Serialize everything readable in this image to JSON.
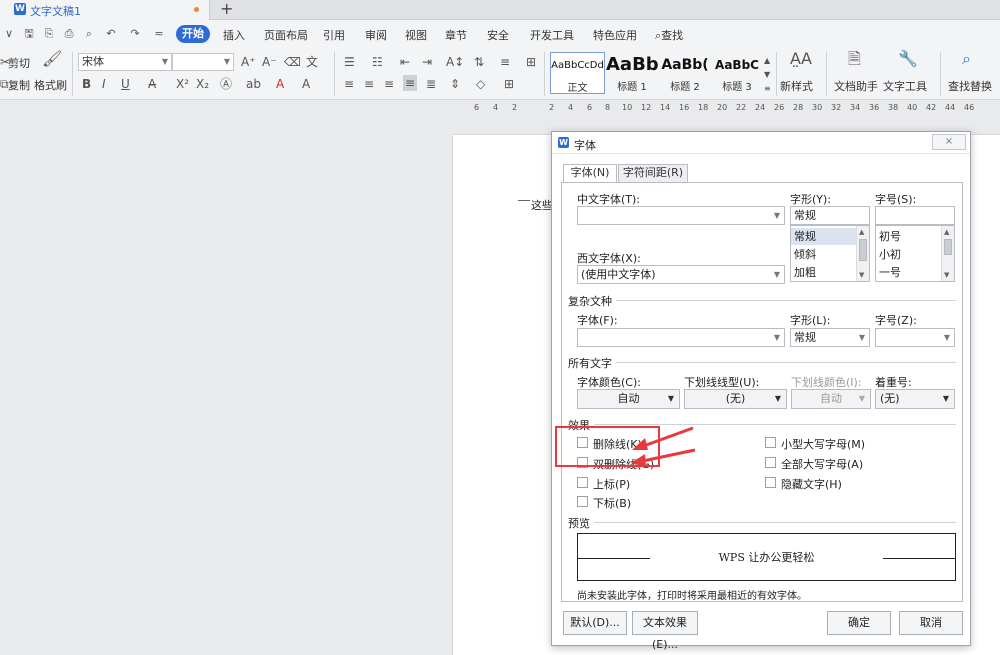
{
  "tabbar": {
    "doc_tab_icon": "W",
    "doc_tab_title": "文字文稿1",
    "new_tab": "+"
  },
  "menu": {
    "items": [
      "开始",
      "插入",
      "页面布局",
      "引用",
      "审阅",
      "视图",
      "章节",
      "安全",
      "开发工具",
      "特色应用"
    ],
    "search": "查找"
  },
  "ribbon": {
    "cut": "剪切",
    "copy": "复制",
    "format_painter": "格式刷",
    "font_name": "宋体",
    "font_size": "",
    "styles": [
      {
        "sample": "AaBbCcDd",
        "label": "正文"
      },
      {
        "sample": "AaBb",
        "label": "标题 1"
      },
      {
        "sample": "AaBb(",
        "label": "标题 2"
      },
      {
        "sample": "AaBbC",
        "label": "标题 3"
      }
    ],
    "new_style": "新样式",
    "doc_assistant": "文档助手",
    "text_tools": "文字工具",
    "find_replace": "查找替换"
  },
  "ruler": {
    "ticks": [
      "6",
      "4",
      "2",
      "2",
      "4",
      "6",
      "8",
      "10",
      "12",
      "14",
      "16",
      "18",
      "20",
      "22",
      "24",
      "26",
      "28",
      "30",
      "32",
      "34",
      "36",
      "38",
      "40",
      "42",
      "44",
      "46"
    ]
  },
  "document": {
    "text": "这些"
  },
  "dialog": {
    "title": "字体",
    "close": "×",
    "tabs": [
      "字体(N)",
      "字符间距(R)"
    ],
    "chinese_font_label": "中文字体(T):",
    "chinese_font_value": "",
    "western_font_label": "西文字体(X):",
    "western_font_value": "(使用中文字体)",
    "style_label": "字形(Y):",
    "style_value": "常规",
    "style_options": [
      "常规",
      "倾斜",
      "加粗"
    ],
    "size_label": "字号(S):",
    "size_value": "",
    "size_options": [
      "初号",
      "小初",
      "一号"
    ],
    "complex_section": "复杂文种",
    "complex_font_label": "字体(F):",
    "complex_font_value": "",
    "complex_style_label": "字形(L):",
    "complex_style_value": "常规",
    "complex_size_label": "字号(Z):",
    "complex_size_value": "",
    "all_text_section": "所有文字",
    "font_color_label": "字体颜色(C):",
    "font_color_value": "自动",
    "underline_type_label": "下划线线型(U):",
    "underline_type_value": "(无)",
    "underline_color_label": "下划线颜色(I):",
    "underline_color_value": "自动",
    "emphasis_label": "着重号:",
    "emphasis_value": "(无)",
    "effects_section": "效果",
    "effects_left": [
      "删除线(K)",
      "双删除线(G)",
      "上标(P)",
      "下标(B)"
    ],
    "effects_right": [
      "小型大写字母(M)",
      "全部大写字母(A)",
      "隐藏文字(H)"
    ],
    "preview_section": "预览",
    "preview_text": "WPS 让办公更轻松",
    "note": "尚未安装此字体，打印时将采用最相近的有效字体。",
    "buttons": {
      "default": "默认(D)...",
      "text_effect": "文本效果(E)...",
      "ok": "确定",
      "cancel": "取消"
    }
  },
  "colors": {
    "accent": "#2e6bd6",
    "annotation": "#e8393d"
  }
}
